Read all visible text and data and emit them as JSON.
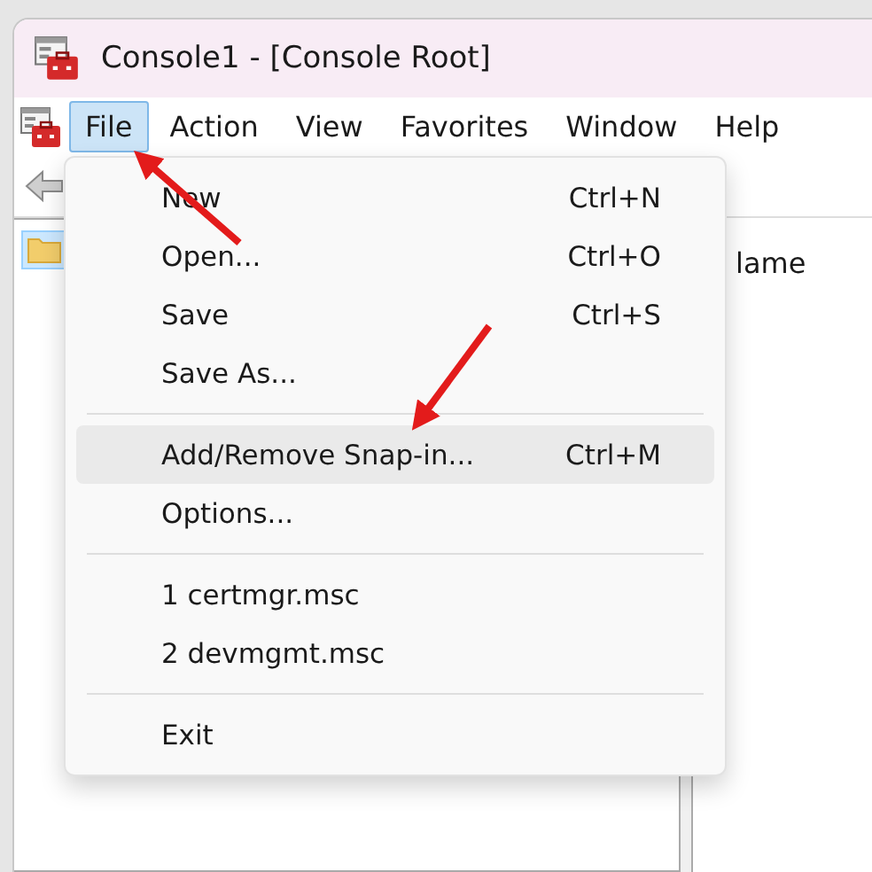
{
  "window": {
    "title": "Console1 - [Console Root]"
  },
  "menu_bar": [
    {
      "label": "File",
      "selected": true
    },
    {
      "label": "Action",
      "selected": false
    },
    {
      "label": "View",
      "selected": false
    },
    {
      "label": "Favorites",
      "selected": false
    },
    {
      "label": "Window",
      "selected": false
    },
    {
      "label": "Help",
      "selected": false
    }
  ],
  "tree": [
    {
      "kind": "folder",
      "selected": true
    }
  ],
  "list_header": "lame",
  "file_menu": [
    {
      "kind": "item",
      "label": "New",
      "shortcut": "Ctrl+N",
      "selected": false
    },
    {
      "kind": "item",
      "label": "Open...",
      "shortcut": "Ctrl+O",
      "selected": false
    },
    {
      "kind": "item",
      "label": "Save",
      "shortcut": "Ctrl+S",
      "selected": false
    },
    {
      "kind": "item",
      "label": "Save As...",
      "selected": false
    },
    {
      "kind": "separator"
    },
    {
      "kind": "item",
      "label": "Add/Remove Snap-in...",
      "shortcut": "Ctrl+M",
      "selected": true
    },
    {
      "kind": "item",
      "label": "Options...",
      "selected": false
    },
    {
      "kind": "separator"
    },
    {
      "kind": "item",
      "label": "1 certmgr.msc",
      "selected": false
    },
    {
      "kind": "item",
      "label": "2 devmgmt.msc",
      "selected": false
    },
    {
      "kind": "separator"
    },
    {
      "kind": "item",
      "label": "Exit",
      "selected": false
    }
  ]
}
